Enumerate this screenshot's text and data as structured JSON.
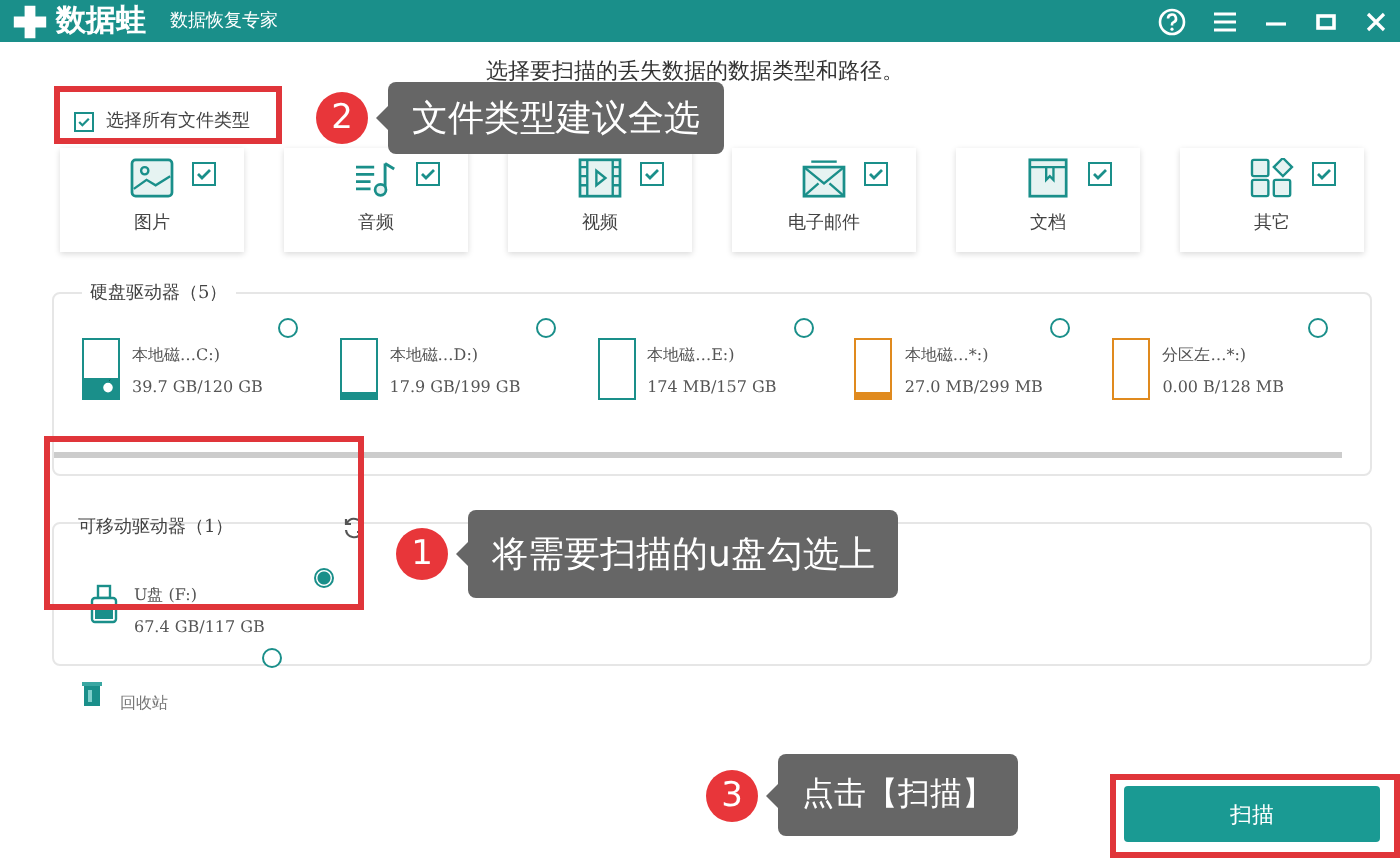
{
  "window": {
    "app_name": "数据蛙",
    "subtitle": "数据恢复专家"
  },
  "intro": "选择要扫描的丢失数据的数据类型和路径。",
  "select_all": {
    "label": "选择所有文件类型",
    "checked": true
  },
  "file_types": [
    {
      "kind": "image",
      "label": "图片",
      "checked": true
    },
    {
      "kind": "audio",
      "label": "音频",
      "checked": true
    },
    {
      "kind": "video",
      "label": "视频",
      "checked": true
    },
    {
      "kind": "email",
      "label": "电子邮件",
      "checked": true
    },
    {
      "kind": "document",
      "label": "文档",
      "checked": true
    },
    {
      "kind": "other",
      "label": "其它",
      "checked": true
    }
  ],
  "hard_drives": {
    "title": "硬盘驱动器（5）",
    "drives": [
      {
        "name": "本地磁…C:)",
        "size": "39.7 GB/120 GB",
        "level": 0.33,
        "color": "#1a8f8a",
        "system": true,
        "selected": false
      },
      {
        "name": "本地磁…D:)",
        "size": "17.9 GB/199 GB",
        "level": 0.09,
        "color": "#1a8f8a",
        "system": false,
        "selected": false
      },
      {
        "name": "本地磁…E:)",
        "size": "174 MB/157 GB",
        "level": 0.0,
        "color": "#1a8f8a",
        "system": false,
        "selected": false
      },
      {
        "name": "本地磁…*:)",
        "size": "27.0 MB/299 MB",
        "level": 0.09,
        "color": "#e08a1e",
        "system": false,
        "selected": false
      },
      {
        "name": "分区左…*:)",
        "size": "0.00  B/128 MB",
        "level": 0.0,
        "color": "#e08a1e",
        "system": false,
        "selected": false
      }
    ]
  },
  "removable_drives": {
    "title": "可移动驱动器（1）",
    "drives": [
      {
        "name": "U盘 (F:)",
        "size": "67.4 GB/117 GB",
        "selected": true
      }
    ]
  },
  "recycle_bin": {
    "label": "回收站",
    "selected": false
  },
  "scan_button": "扫描",
  "annotations": [
    {
      "number": "2",
      "text": "文件类型建议全选"
    },
    {
      "number": "1",
      "text": "将需要扫描的u盘勾选上"
    },
    {
      "number": "3",
      "text": "点击【扫描】"
    }
  ]
}
